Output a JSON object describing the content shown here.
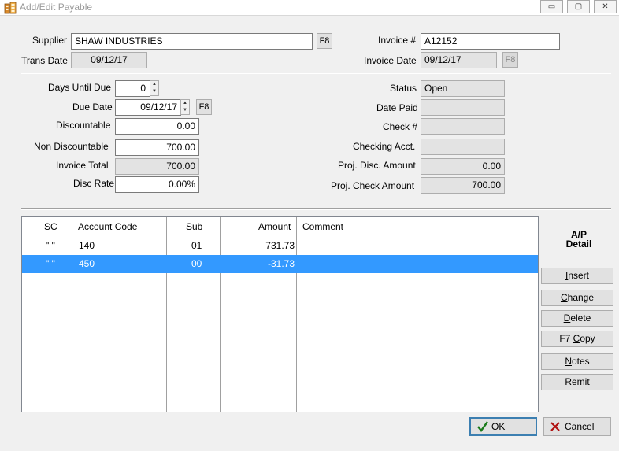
{
  "window": {
    "title": "Add/Edit Payable",
    "controls": {
      "minimize": "▭",
      "maximize": "▢",
      "close": "✕"
    }
  },
  "header": {
    "supplier_label": "Supplier",
    "supplier_value": "SHAW INDUSTRIES",
    "supplier_lookup": "F8",
    "trans_date_label": "Trans Date",
    "trans_date_value": "09/12/17",
    "invoice_no_label": "Invoice #",
    "invoice_no_value": "A12152",
    "invoice_date_label": "Invoice Date",
    "invoice_date_value": "09/12/17",
    "invoice_date_lookup": "F8"
  },
  "terms": {
    "days_until_due_label": "Days Until Due",
    "days_until_due_value": "0",
    "due_date_label": "Due Date",
    "due_date_value": "09/12/17",
    "due_date_lookup": "F8",
    "discountable_label": "Discountable",
    "discountable_value": "0.00",
    "non_discountable_label": "Non Discountable",
    "non_discountable_value": "700.00",
    "invoice_total_label": "Invoice Total",
    "invoice_total_value": "700.00",
    "disc_rate_label": "Disc Rate",
    "disc_rate_value": "0.00%"
  },
  "status_panel": {
    "status_label": "Status",
    "status_value": "Open",
    "date_paid_label": "Date Paid",
    "date_paid_value": "",
    "check_no_label": "Check #",
    "check_no_value": "",
    "checking_acct_label": "Checking Acct.",
    "checking_acct_value": "",
    "proj_disc_label": "Proj. Disc. Amount",
    "proj_disc_value": "0.00",
    "proj_check_label": "Proj. Check Amount",
    "proj_check_value": "700.00"
  },
  "grid": {
    "columns": [
      "SC",
      "Account Code",
      "Sub",
      "Amount",
      "Comment"
    ],
    "rows": [
      {
        "sc": "\" \"",
        "account": "140",
        "sub": "01",
        "amount": "731.73",
        "comment": ""
      },
      {
        "sc": "\" \"",
        "account": "450",
        "sub": "00",
        "amount": "-31.73",
        "comment": ""
      }
    ],
    "selected_row": 1
  },
  "detail_panel": {
    "title_line1": "A/P",
    "title_line2": "Detail",
    "buttons": {
      "insert": {
        "u": "I",
        "rest": "nsert"
      },
      "change": {
        "u": "C",
        "rest": "hange"
      },
      "delete": {
        "u": "D",
        "rest": "elete"
      },
      "copy": {
        "pre": "F7 ",
        "u": "C",
        "rest": "opy"
      },
      "notes": {
        "u": "N",
        "rest": "otes"
      },
      "remit": {
        "u": "R",
        "rest": "emit"
      }
    }
  },
  "footer": {
    "ok": {
      "u": "O",
      "rest": "K"
    },
    "cancel": {
      "u": "C",
      "rest": "ancel"
    }
  },
  "colors": {
    "selection": "#3399ff",
    "ok_check": "#1a7a1a",
    "cancel_x": "#b01010"
  }
}
